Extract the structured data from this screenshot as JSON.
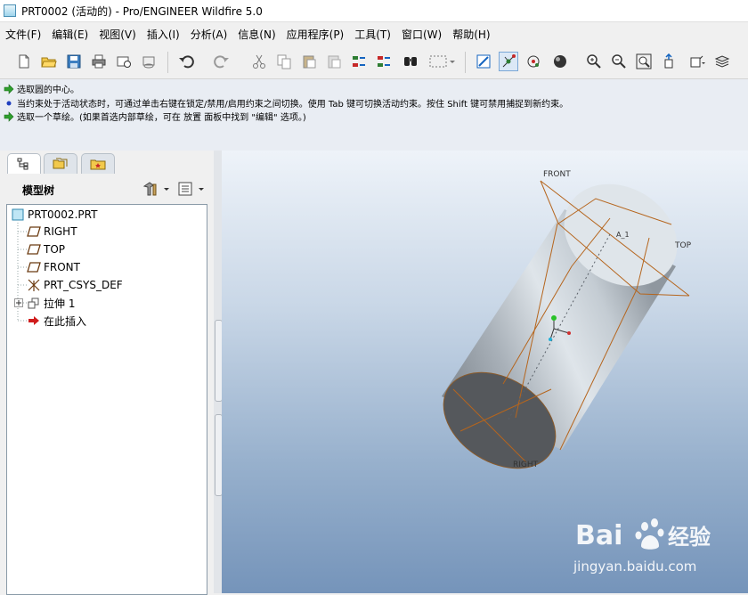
{
  "window": {
    "title": "PRT0002 (活动的) - Pro/ENGINEER Wildfire 5.0"
  },
  "menu": [
    {
      "label": "文件(F)"
    },
    {
      "label": "编辑(E)"
    },
    {
      "label": "视图(V)"
    },
    {
      "label": "插入(I)"
    },
    {
      "label": "分析(A)"
    },
    {
      "label": "信息(N)"
    },
    {
      "label": "应用程序(P)"
    },
    {
      "label": "工具(T)"
    },
    {
      "label": "窗口(W)"
    },
    {
      "label": "帮助(H)"
    }
  ],
  "toolbar": {
    "icons": [
      "new-icon",
      "open-icon",
      "save-icon",
      "print-icon",
      "send-mail-icon",
      "attach-icon",
      "undo-icon",
      "redo-icon",
      "cut-icon",
      "copy-icon",
      "paste-icon",
      "paste-special-icon",
      "regenerate-icon",
      "regenerate-manager-icon",
      "find-icon",
      "select-box-icon",
      "sketch-view-icon",
      "datum-point-icon",
      "spin-center-icon",
      "shading-icon",
      "zoom-in-icon",
      "zoom-out-icon",
      "refit-icon",
      "reorient-icon",
      "saved-views-icon",
      "layers-icon"
    ]
  },
  "messages": [
    {
      "icon": "green-arrow-icon",
      "text": "选取圆的中心。"
    },
    {
      "icon": "blue-dot-icon",
      "text": "当约束处于活动状态时，可通过单击右键在锁定/禁用/启用约束之间切换。使用 Tab 键可切换活动约束。按住 Shift 键可禁用捕捉到新约束。"
    },
    {
      "icon": "green-arrow-icon",
      "text": "选取一个草绘。(如果首选内部草绘，可在 放置 面板中找到 \"编辑\" 选项。)"
    }
  ],
  "panel": {
    "tabs": [
      "model-tree-tab",
      "folder-browser-tab",
      "favorites-tab"
    ],
    "tree_title": "模型树"
  },
  "tree": {
    "root": "PRT0002.PRT",
    "items": [
      {
        "label": "RIGHT",
        "icon": "datum-plane-icon"
      },
      {
        "label": "TOP",
        "icon": "datum-plane-icon"
      },
      {
        "label": "FRONT",
        "icon": "datum-plane-icon"
      },
      {
        "label": "PRT_CSYS_DEF",
        "icon": "csys-icon"
      },
      {
        "label": "拉伸 1",
        "icon": "extrude-icon",
        "expandable": true
      },
      {
        "label": "在此插入",
        "icon": "insert-here-arrow-icon"
      }
    ]
  },
  "viewport": {
    "labels": {
      "front": "FRONT",
      "top": "TOP",
      "right": "RIGHT",
      "axis": "A_1"
    },
    "colors": {
      "datum_orange": "#b5651d",
      "model_gray": "#8f979f",
      "bg_top": "#eef3f9",
      "bg_bottom": "#7594ba"
    }
  },
  "watermark": {
    "brand": "Bai",
    "brand2": "经验",
    "url": "jingyan.baidu.com"
  }
}
